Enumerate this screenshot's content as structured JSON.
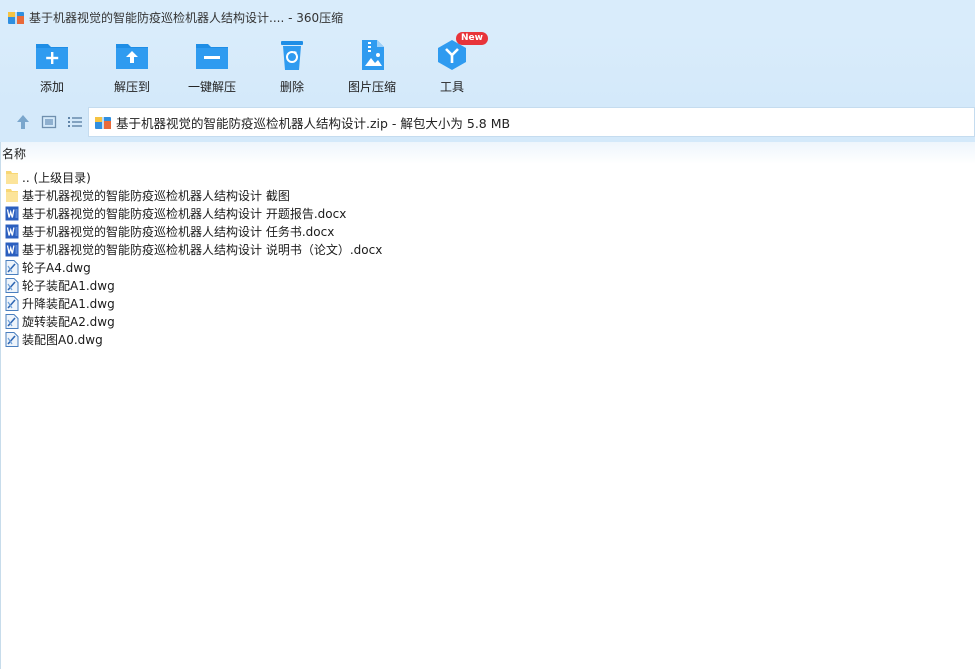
{
  "window": {
    "title": "基于机器视觉的智能防疫巡检机器人结构设计.... - 360压缩"
  },
  "toolbar": {
    "items": [
      {
        "label": "添加",
        "icon": "add-folder-icon"
      },
      {
        "label": "解压到",
        "icon": "extract-to-icon"
      },
      {
        "label": "一键解压",
        "icon": "one-click-extract-icon"
      },
      {
        "label": "删除",
        "icon": "recycle-bin-icon"
      },
      {
        "label": "图片压缩",
        "icon": "image-compress-icon"
      },
      {
        "label": "工具",
        "icon": "tools-icon",
        "badge": "New"
      }
    ]
  },
  "nav": {
    "path": "基于机器视觉的智能防疫巡检机器人结构设计.zip - 解包大小为 5.8 MB"
  },
  "list": {
    "column_name": "名称",
    "rows": [
      {
        "name": ".. (上级目录)",
        "type": "folder"
      },
      {
        "name": "基于机器视觉的智能防疫巡检机器人结构设计 截图",
        "type": "folder"
      },
      {
        "name": "基于机器视觉的智能防疫巡检机器人结构设计 开题报告.docx",
        "type": "word"
      },
      {
        "name": "基于机器视觉的智能防疫巡检机器人结构设计 任务书.docx",
        "type": "word"
      },
      {
        "name": "基于机器视觉的智能防疫巡检机器人结构设计 说明书（论文）.docx",
        "type": "word"
      },
      {
        "name": "轮子A4.dwg",
        "type": "dwg"
      },
      {
        "name": "轮子装配A1.dwg",
        "type": "dwg"
      },
      {
        "name": "升降装配A1.dwg",
        "type": "dwg"
      },
      {
        "name": "旋转装配A2.dwg",
        "type": "dwg"
      },
      {
        "name": "装配图A0.dwg",
        "type": "dwg"
      }
    ]
  },
  "colors": {
    "toolbar_bg": "#d4e9fa",
    "icon_blue": "#1e8ee6",
    "badge_red": "#e8343a",
    "folder_yellow": "#f8d775",
    "word_blue": "#2b5fbf"
  }
}
